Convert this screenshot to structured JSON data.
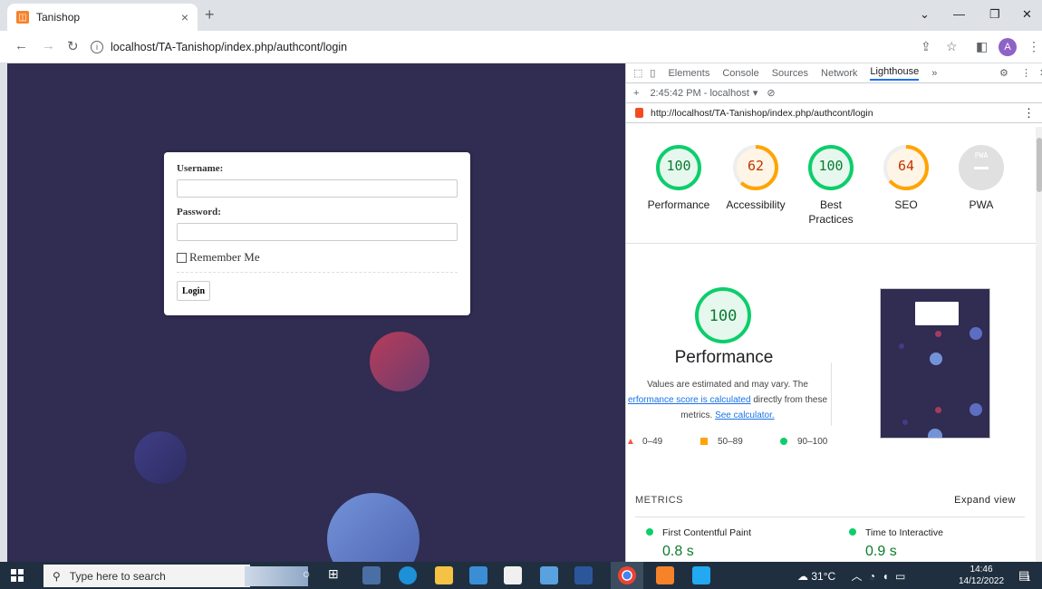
{
  "browser": {
    "tab_title": "Tanishop",
    "tab_close": "×",
    "new_tab": "+",
    "url": "localhost/TA-Tanishop/index.php/authcont/login"
  },
  "login": {
    "username_label": "Username:",
    "password_label": "Password:",
    "remember_label": "Remember Me",
    "login_button": "Login"
  },
  "devtools": {
    "tabs": [
      "Elements",
      "Console",
      "Sources",
      "Network",
      "Lighthouse"
    ],
    "report_time": "2:45:42 PM - localhost",
    "report_url": "http://localhost/TA-Tanishop/index.php/authcont/login",
    "gauges": [
      {
        "score": "100",
        "label": "Performance",
        "value": 100,
        "color": "#0cce6b"
      },
      {
        "score": "62",
        "label": "Accessibility",
        "value": 62,
        "color": "#ffa400"
      },
      {
        "score": "100",
        "label": "Best Practices",
        "value": 100,
        "color": "#0cce6b"
      },
      {
        "score": "64",
        "label": "SEO",
        "value": 64,
        "color": "#ffa400"
      },
      {
        "score": "PWA",
        "label": "PWA",
        "value": 0,
        "color": "#9e9e9e"
      }
    ],
    "perf_score": "100",
    "perf_title": "Performance",
    "perf_desc_1": "Values are estimated and may vary. The",
    "perf_link_1": "erformance score is calculated",
    "perf_desc_2": " directly from these",
    "perf_desc_3": "metrics. ",
    "perf_link_2": "See calculator.",
    "legend": [
      "0–49",
      "50–89",
      "90–100"
    ],
    "metrics_label": "METRICS",
    "expand_view": "Expand view",
    "metrics": [
      {
        "name": "First Contentful Paint",
        "value": "0.8 s"
      },
      {
        "name": "Time to Interactive",
        "value": "0.9 s"
      }
    ]
  },
  "taskbar": {
    "search_placeholder": "Type here to search",
    "temperature": "31°C",
    "time": "14:46",
    "date": "14/12/2022",
    "notifications": "1"
  },
  "colors": {
    "page_bg": "#302c52",
    "pass": "#0cce6b",
    "average": "#ffa400",
    "fail": "#ff4e42"
  }
}
